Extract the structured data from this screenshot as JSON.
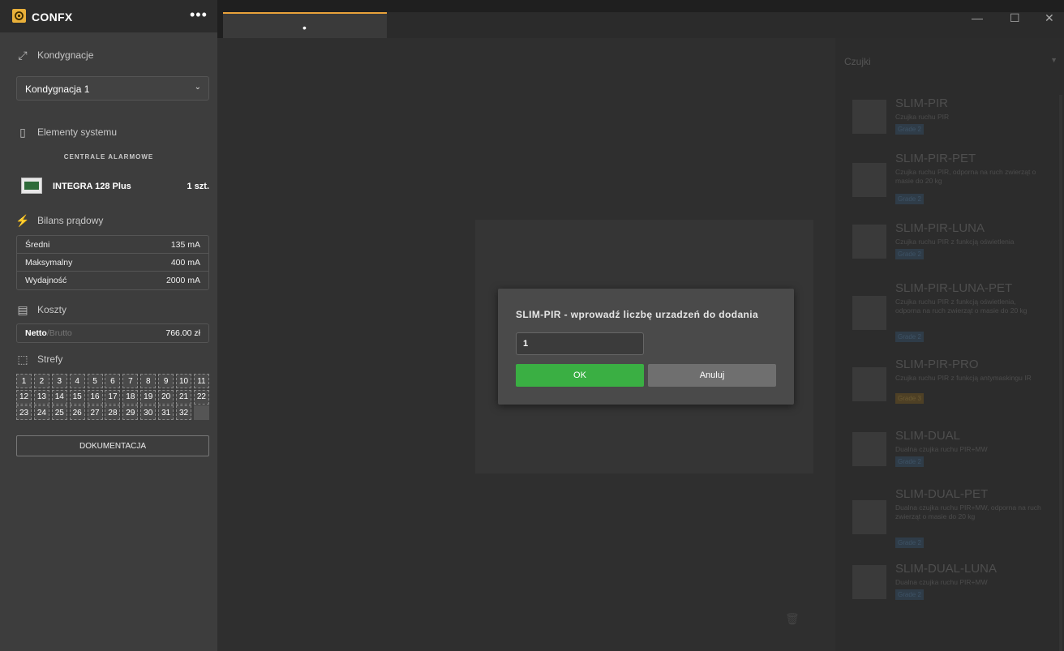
{
  "app": {
    "title": "CONFX",
    "more_label": "•••"
  },
  "sidebar": {
    "floors_header": "Kondygnacje",
    "floor_select": "Kondygnacja 1",
    "system_header": "Elementy systemu",
    "category": "CENTRALE ALARMOWE",
    "device": {
      "name": "INTEGRA 128 Plus",
      "qty": "1 szt."
    },
    "power_header": "Bilans prądowy",
    "power_rows": [
      {
        "label": "Średni",
        "value": "135 mA"
      },
      {
        "label": "Maksymalny",
        "value": "400 mA"
      },
      {
        "label": "Wydajność",
        "value": "2000 mA"
      }
    ],
    "costs_header": "Koszty",
    "cost": {
      "netto": "Netto",
      "brutto": "/Brutto",
      "value": "766.00 zł"
    },
    "zones_header": "Strefy",
    "zones": [
      "1",
      "2",
      "3",
      "4",
      "5",
      "6",
      "7",
      "8",
      "9",
      "10",
      "11",
      "12",
      "13",
      "14",
      "15",
      "16",
      "17",
      "18",
      "19",
      "20",
      "21",
      "22",
      "23",
      "24",
      "25",
      "26",
      "27",
      "28",
      "29",
      "30",
      "31",
      "32"
    ],
    "doc_button": "DOKUMENTACJA"
  },
  "tabs": {
    "active_label": "•"
  },
  "window": {
    "minimize": "—",
    "maximize": "☐",
    "close": "✕"
  },
  "right_panel": {
    "header": "Czujki",
    "devices": [
      {
        "name": "SLIM-PIR",
        "desc": "Czujka ruchu PIR",
        "grade": "Grade 2"
      },
      {
        "name": "SLIM-PIR-PET",
        "desc": "Czujka ruchu PIR, odporna na ruch zwierząt o masie do 20 kg",
        "grade": "Grade 2"
      },
      {
        "name": "SLIM-PIR-LUNA",
        "desc": "Czujka ruchu PIR z funkcją oświetlenia",
        "grade": "Grade 2"
      },
      {
        "name": "SLIM-PIR-LUNA-PET",
        "desc": "Czujka ruchu PIR z funkcją oświetlenia, odporna na ruch zwierząt o masie do 20 kg",
        "grade": "Grade 2"
      },
      {
        "name": "SLIM-PIR-PRO",
        "desc": "Czujka ruchu PIR z funkcją antymaskingu IR",
        "grade": "Grade 3"
      },
      {
        "name": "SLIM-DUAL",
        "desc": "Dualna czujka ruchu PIR+MW",
        "grade": "Grade 2"
      },
      {
        "name": "SLIM-DUAL-PET",
        "desc": "Dualna czujka ruchu PIR+MW, odporna na ruch zwierząt o masie do 20 kg",
        "grade": "Grade 2"
      },
      {
        "name": "SLIM-DUAL-LUNA",
        "desc": "Dualna czujka ruchu PIR+MW",
        "grade": "Grade 2"
      }
    ]
  },
  "dialog": {
    "title": "SLIM-PIR - wprowadź liczbę urzadzeń do dodania",
    "input_value": "1",
    "ok_label": "OK",
    "cancel_label": "Anuluj"
  },
  "colors": {
    "accent": "#e9a23a",
    "ok": "#3aaf43",
    "cancel": "#6f6f6f",
    "sidebar": "#3d3d3d"
  }
}
